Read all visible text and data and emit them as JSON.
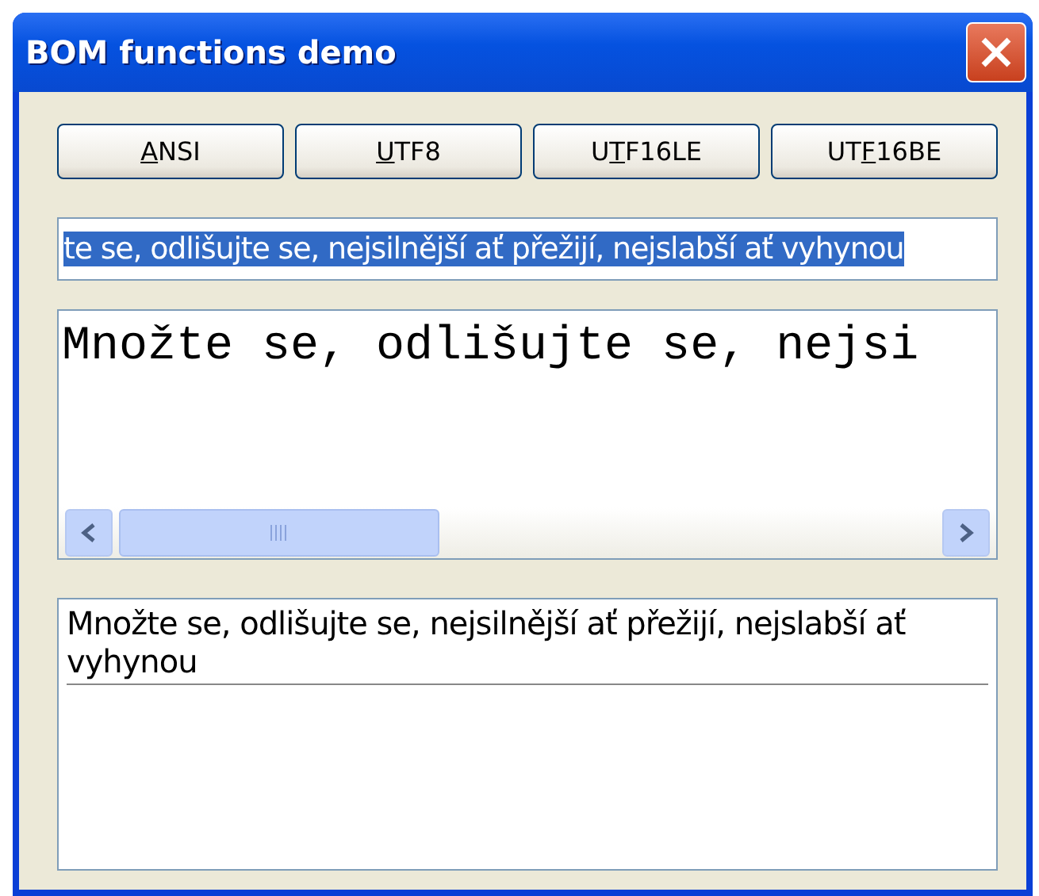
{
  "window": {
    "title": "BOM functions demo"
  },
  "buttons": [
    {
      "key": "A",
      "after": "NSI"
    },
    {
      "key": "U",
      "after": "TF8"
    },
    {
      "before": "U",
      "key": "T",
      "after": "F16LE"
    },
    {
      "before": "UT",
      "key": "F",
      "after": "16BE"
    }
  ],
  "single_line_field": {
    "value": "te se, odlišujte se, nejsilnější ať přežijí, nejslabší ať vyhynou",
    "selected": true
  },
  "mono_text_area": {
    "value": "Množte se, odlišujte se, nejsi"
  },
  "output_box": {
    "text": "Množte se, odlišujte se, nejsilnější ať přežijí, nejslabší ať vyhynou"
  }
}
